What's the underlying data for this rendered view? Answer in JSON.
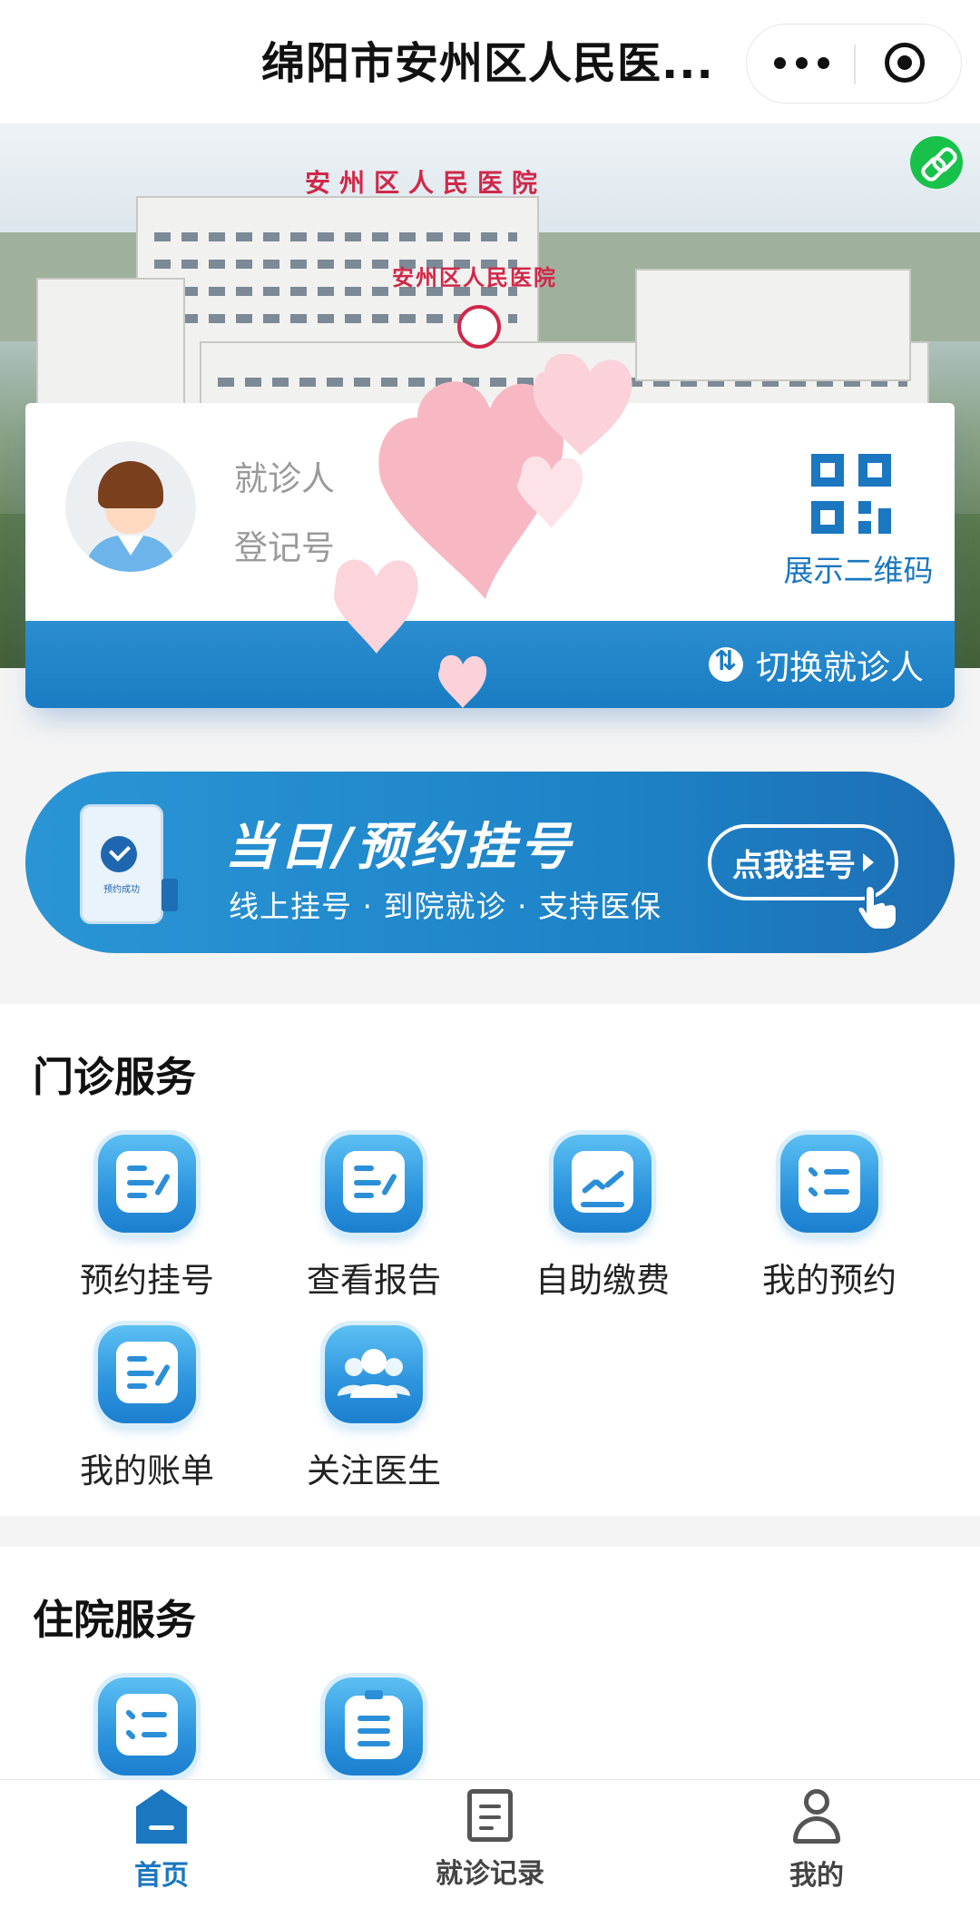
{
  "header": {
    "title": "绵阳市安州区人民医..."
  },
  "banner": {
    "sign_top": "安州区人民医院",
    "sign_bottom": "安州区人民医院"
  },
  "patient_card": {
    "patient_label": "就诊人",
    "reg_no_label": "登记号",
    "qr_label": "展示二维码",
    "switch_label": "切换就诊人"
  },
  "register_banner": {
    "title": "当日/预约挂号",
    "subtitle": "线上挂号 · 到院就诊 · 支持医保",
    "button": "点我挂号",
    "phone_caption": "预约成功"
  },
  "outpatient": {
    "title": "门诊服务",
    "items": [
      {
        "label": "预约挂号",
        "icon": "form-pen-icon"
      },
      {
        "label": "查看报告",
        "icon": "form-pen-icon"
      },
      {
        "label": "自助缴费",
        "icon": "trend-chart-icon"
      },
      {
        "label": "我的预约",
        "icon": "checklist-icon"
      },
      {
        "label": "我的账单",
        "icon": "form-pen-icon"
      },
      {
        "label": "关注医生",
        "icon": "group-users-icon"
      }
    ]
  },
  "inpatient": {
    "title": "住院服务",
    "items": [
      {
        "label": "",
        "icon": "checklist-icon"
      },
      {
        "label": "",
        "icon": "clipboard-icon"
      }
    ]
  },
  "tabbar": {
    "items": [
      {
        "label": "首页",
        "active": true,
        "icon": "home-icon"
      },
      {
        "label": "就诊记录",
        "active": false,
        "icon": "records-icon"
      },
      {
        "label": "我的",
        "active": false,
        "icon": "user-icon"
      }
    ]
  },
  "colors": {
    "primary": "#1a77c0",
    "accent_green": "#18c24a",
    "text_gray": "#9a9a9a"
  }
}
